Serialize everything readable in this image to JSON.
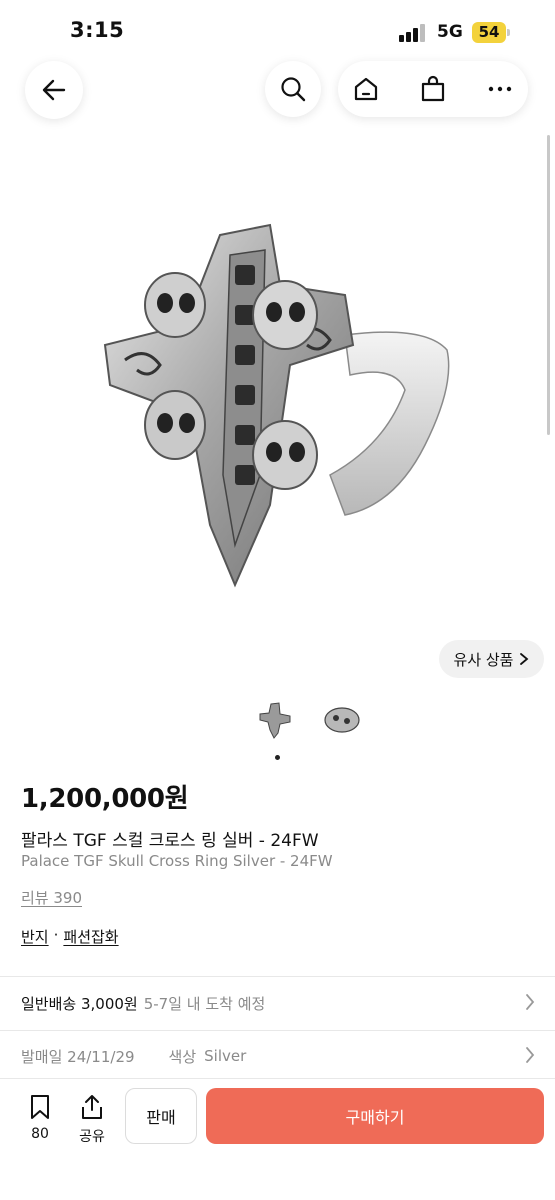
{
  "status": {
    "time": "3:15",
    "network": "5G",
    "battery": "54"
  },
  "nav": {
    "back_icon": "back-arrow-icon",
    "search_icon": "search-icon",
    "home_icon": "home-icon",
    "cart_icon": "shopping-bag-icon",
    "more_icon": "more-dots-icon"
  },
  "similar": {
    "label": "유사 상품"
  },
  "product": {
    "price": "1,200,000원",
    "title_ko": "팔라스 TGF 스컬 크로스 링 실버 - 24FW",
    "title_en": "Palace TGF Skull Cross Ring Silver - 24FW",
    "reviews": "리뷰 390",
    "categories": [
      "반지",
      "패션잡화"
    ],
    "category_sep": "·"
  },
  "shipping": {
    "label": "일반배송 3,000원",
    "eta": "5-7일 내 도착 예정"
  },
  "release": {
    "label": "발매일 24/11/29",
    "color_label": "색상",
    "color_value": "Silver"
  },
  "bottom": {
    "bookmark_count": "80",
    "share_label": "공유",
    "sell_label": "판매",
    "buy_label": "구매하기"
  },
  "colors": {
    "buy_button": "#ef6b57",
    "battery": "#f3d23c"
  }
}
